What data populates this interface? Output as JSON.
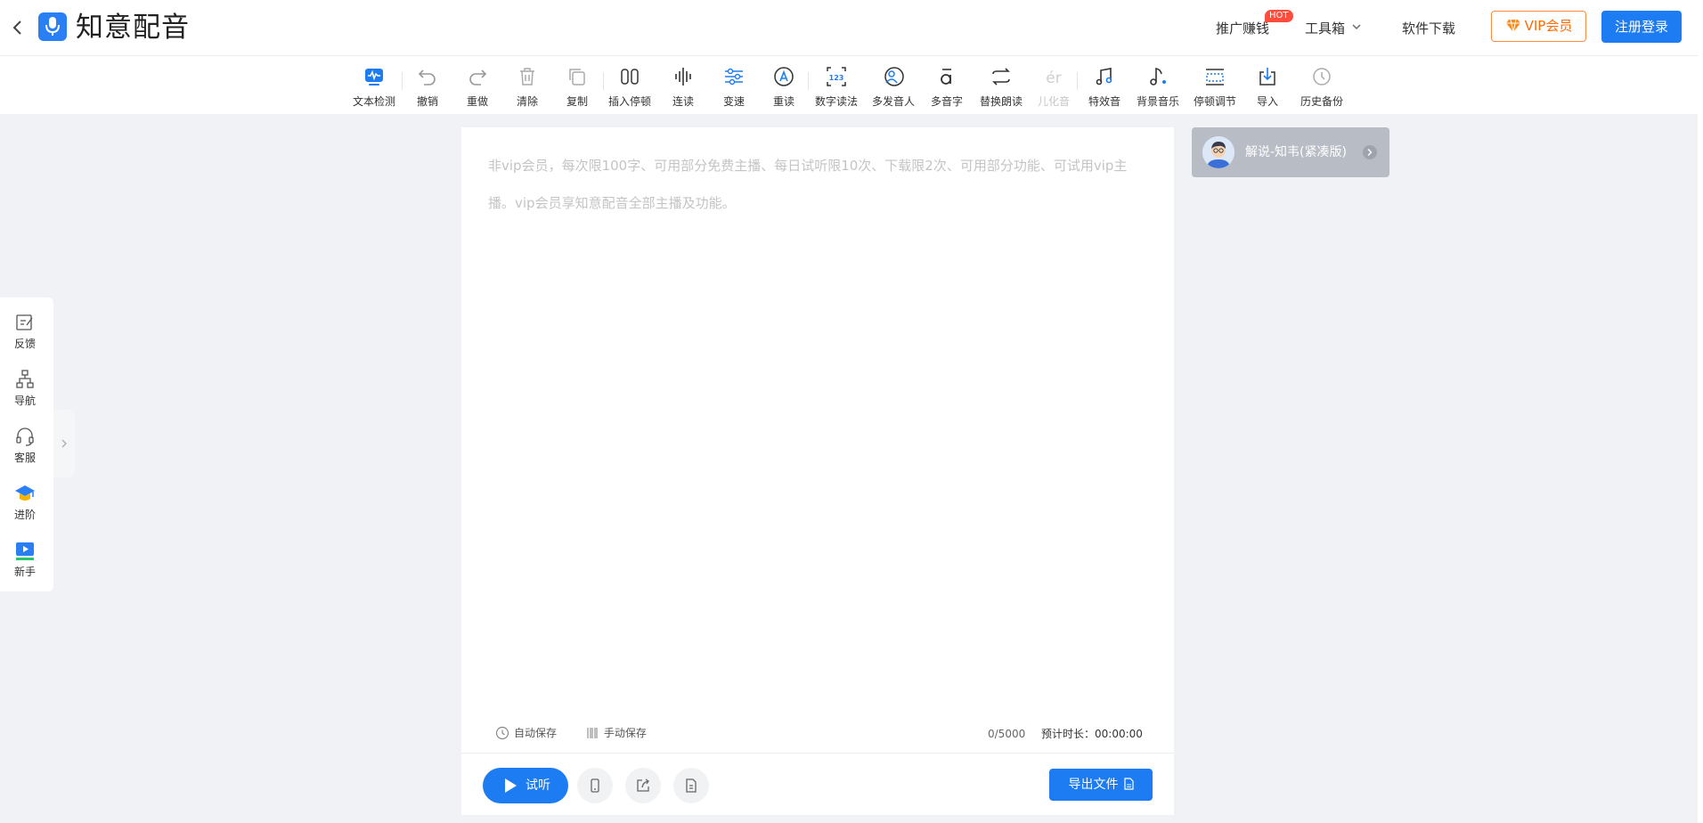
{
  "header": {
    "app_title": "知意配音",
    "nav": {
      "promote": "推广赚钱",
      "hot_badge": "HOT",
      "toolbox": "工具箱",
      "download": "软件下载"
    },
    "vip_label": "VIP会员",
    "login_label": "注册登录"
  },
  "toolbar": {
    "text_check": "文本检测",
    "undo": "撤销",
    "redo": "重做",
    "clear": "清除",
    "copy": "复制",
    "insert_pause": "插入停顿",
    "continuous": "连读",
    "speed": "变速",
    "stress": "重读",
    "number_reading": "数字读法",
    "multi_speaker": "多发音人",
    "polyphone": "多音字",
    "replace_reading": "替换朗读",
    "erhua": "儿化音",
    "sound_effect": "特效音",
    "bgm": "背景音乐",
    "pause_adjust": "停顿调节",
    "import": "导入",
    "history_backup": "历史备份"
  },
  "editor": {
    "placeholder": "非vip会员，每次限100字、可用部分免费主播、每日试听限10次、下载限2次、可用部分功能、可试用vip主播。vip会员享知意配音全部主播及功能。",
    "auto_save": "自动保存",
    "manual_save": "手动保存",
    "char_count": "0/5000",
    "duration": "预计时长：00:00:00",
    "play_label": "试听",
    "export_label": "导出文件"
  },
  "voice": {
    "name": "解说-知韦(紧凑版)"
  },
  "side": {
    "feedback": "反馈",
    "nav": "导航",
    "service": "客服",
    "advanced": "进阶",
    "beginner": "新手"
  },
  "colors": {
    "primary": "#1d7cf2",
    "vip_orange": "#ff6a00",
    "hot_red": "#ff4d3d",
    "background": "#f0f2f5"
  }
}
